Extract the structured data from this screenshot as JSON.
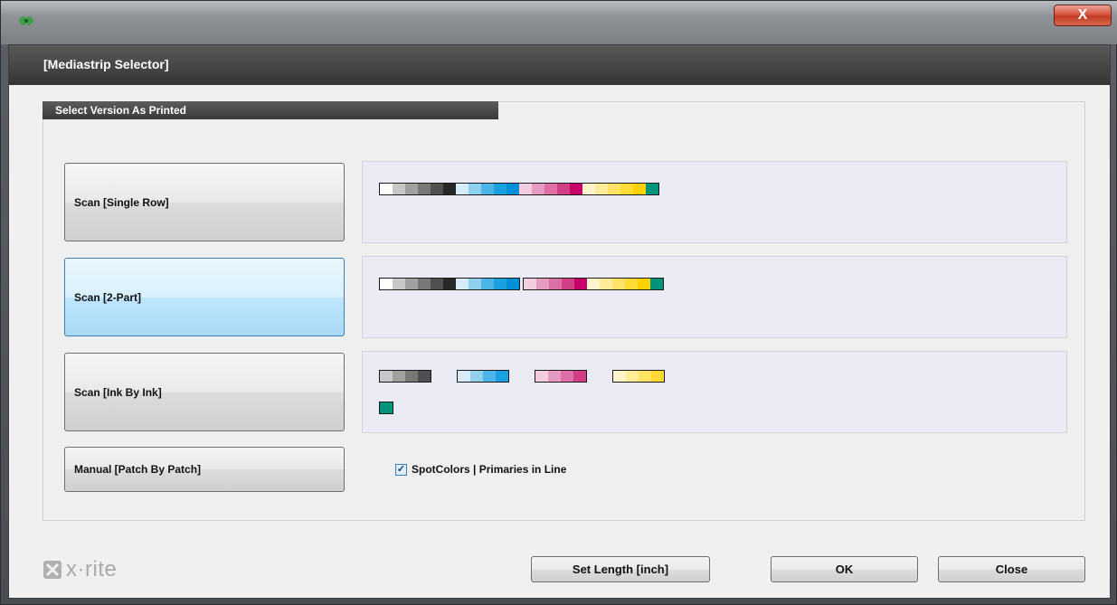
{
  "window": {
    "close_glyph": "X"
  },
  "header": {
    "title": "[Mediastrip Selector]"
  },
  "group": {
    "title": "Select Version As Printed"
  },
  "options": [
    {
      "label": "Scan [Single Row]"
    },
    {
      "label": "Scan [2-Part]",
      "selected": true
    },
    {
      "label": "Scan [Ink By Ink]"
    },
    {
      "label": "Manual [Patch By Patch]"
    }
  ],
  "checkbox": {
    "label": "SpotColors | Primaries in Line",
    "checked": true,
    "mark": "✓"
  },
  "footer": {
    "logo_text": "x·rite",
    "set_length_label": "Set Length [inch]",
    "ok_label": "OK",
    "close_label": "Close"
  },
  "colors": {
    "grays": [
      "#ffffff",
      "#c8c8c8",
      "#a0a0a0",
      "#787878",
      "#505050",
      "#282828"
    ],
    "cyans": [
      "#d6ecf8",
      "#8fd0ef",
      "#4bb5e8",
      "#1a9fe0",
      "#0090d8"
    ],
    "magentas": [
      "#f2cde0",
      "#e79ac0",
      "#dd6fa4",
      "#d33f87",
      "#c8006a"
    ],
    "yellows": [
      "#fff4cc",
      "#ffec99",
      "#ffe366",
      "#ffdb33",
      "#ffd200"
    ],
    "green": "#00957a"
  }
}
